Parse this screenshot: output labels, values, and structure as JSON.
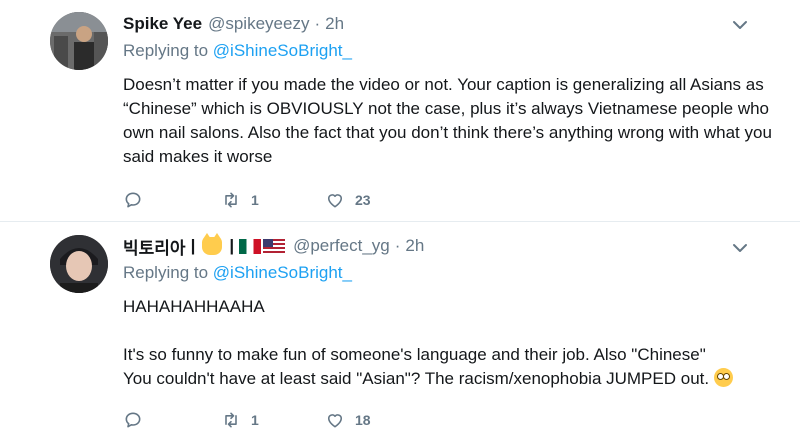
{
  "tweets": [
    {
      "fullname": "Spike Yee",
      "handle": "@spikeyeezy",
      "dot": "·",
      "time": "2h",
      "replying_label": "Replying to",
      "replying_to": "@iShineSoBright_",
      "text": "Doesn’t matter if you made the video or not. Your caption is generalizing all Asians as “Chinese” which is OBVIOUSLY not the case, plus it’s always Vietnamese people who own nail salons. Also the fact that you don’t think there’s anything wrong with what you said makes it worse",
      "replies": "",
      "retweets": "1",
      "likes": "23"
    },
    {
      "fullname_part1": "빅토리아",
      "separator": "|",
      "emoji_cat": "cat-face-emoji",
      "flags": [
        "mexico-flag",
        "usa-flag"
      ],
      "handle": "@perfect_yg",
      "dot": "·",
      "time": "2h",
      "replying_label": "Replying to",
      "replying_to": "@iShineSoBright_",
      "text": "HAHAHAHHAAHA\n\nIt's so funny to make fun of someone's language and their job. Also \"Chinese\"\nYou couldn't have at least said \"Asian\"? The racism/xenophobia JUMPED out.",
      "text_emoji": "face-with-rolling-eyes-emoji",
      "replies": "",
      "retweets": "1",
      "likes": "18"
    }
  ],
  "colors": {
    "link": "#1da1f2",
    "muted": "#657786",
    "text": "#14171a",
    "divider": "#e6ecf0"
  },
  "icons": {
    "reply": "reply-icon",
    "retweet": "retweet-icon",
    "like": "heart-icon",
    "caret": "chevron-down-icon"
  }
}
